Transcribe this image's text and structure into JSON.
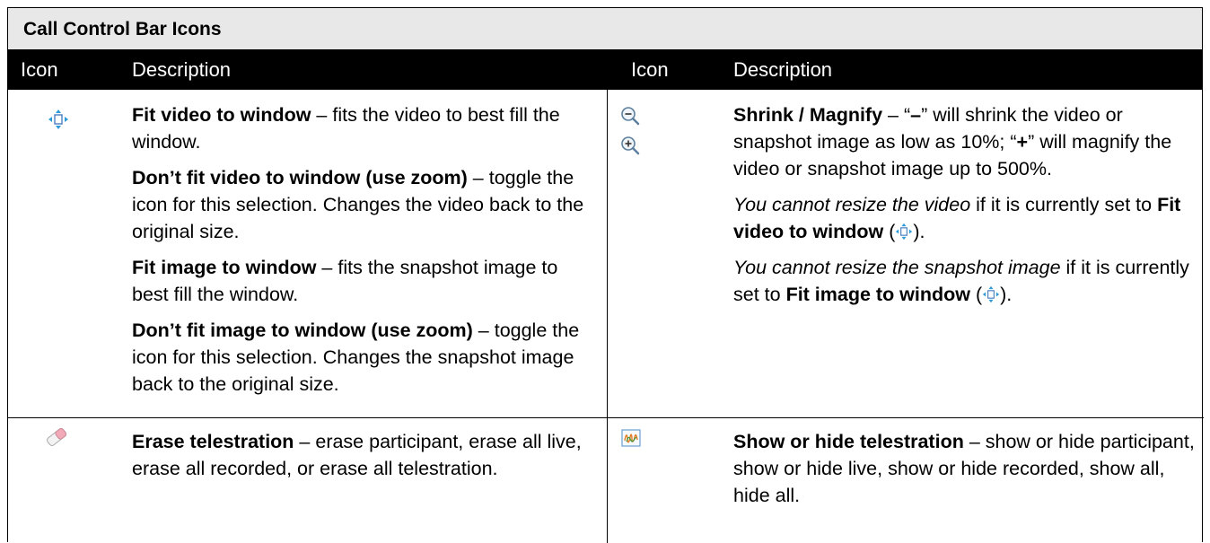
{
  "table": {
    "title": "Call Control Bar Icons",
    "headers": {
      "icon_left": "Icon",
      "desc_left": "Description",
      "icon_right": "Icon",
      "desc_right": "Description"
    }
  },
  "rows": [
    {
      "left": {
        "icon": "fit-window-arrows-icon",
        "paragraphs": [
          {
            "bold": "Fit video to window",
            "text": " – fits the video to best fill the window."
          },
          {
            "bold": "Don’t fit video to window (use zoom)",
            "text": " – toggle the icon for this selection. Changes the video back to the original size."
          },
          {
            "bold": "Fit image to window",
            "text": " – fits the snapshot image to best fill the window."
          },
          {
            "bold": "Don’t fit image to window (use zoom)",
            "text": " – toggle the icon for this selection. Changes the snapshot image back to the original size."
          }
        ]
      },
      "right": {
        "icons": [
          "zoom-out-icon",
          "zoom-in-icon"
        ],
        "p1": {
          "bold": "Shrink / Magnify",
          "t1": " – “",
          "minus": "–",
          "t2": "” will shrink the video or snapshot image as low as 10%; “",
          "plus": "+",
          "t3": "” will magnify the video or snapshot image up to 500%."
        },
        "p2": {
          "italic": "You cannot resize the video",
          "t1": " if it is currently set to ",
          "bold": "Fit video to window",
          "t2": " (",
          "t3": ")."
        },
        "p3": {
          "italic": "You cannot resize the snapshot image",
          "t1": " if it is currently set to ",
          "bold": "Fit image to window",
          "t2": " (",
          "t3": ")."
        }
      }
    },
    {
      "left": {
        "icon": "eraser-icon",
        "bold": "Erase telestration",
        "text": " – erase participant, erase all live, erase all recorded, or erase all telestration."
      },
      "right": {
        "icon": "telestration-toggle-icon",
        "bold": "Show or hide telestration",
        "text": " – show or hide participant, show or hide live, show or hide recorded, show all, hide all."
      }
    }
  ]
}
